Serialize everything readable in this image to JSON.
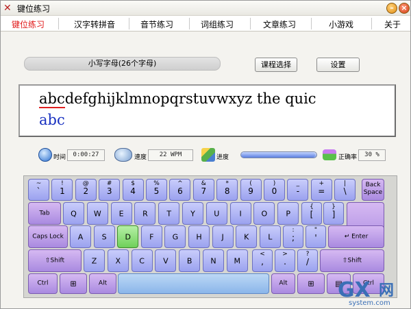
{
  "window": {
    "title": "键位练习",
    "minimize_icon": "minimize-icon",
    "close_icon": "close-icon"
  },
  "menu": {
    "items": [
      "键位练习",
      "汉字转拼音",
      "音节练习",
      "词组练习",
      "文章练习",
      "小游戏",
      "关于"
    ],
    "active_index": 0
  },
  "lesson": {
    "label": "小写字母(26个字母)"
  },
  "buttons": {
    "course_select": "课程选择",
    "settings": "设置"
  },
  "practice": {
    "line1_typed": "abc",
    "line1_rest": "defghijklmnopqrstuvwxyz the quic",
    "line2": "abc"
  },
  "stats": {
    "time_label": "时间",
    "time_value": "0:00:27",
    "speed_label": "速度",
    "speed_value": "22 WPM",
    "progress_label": "进度",
    "progress_fraction": 0.98,
    "accuracy_label": "正确率",
    "accuracy_value": "30 %"
  },
  "keyboard": {
    "row1": [
      [
        "~",
        "`"
      ],
      [
        "!",
        "1"
      ],
      [
        "@",
        "2"
      ],
      [
        "#",
        "3"
      ],
      [
        "$",
        "4"
      ],
      [
        "%",
        "5"
      ],
      [
        "^",
        "6"
      ],
      [
        "&",
        "7"
      ],
      [
        "*",
        "8"
      ],
      [
        "(",
        "9"
      ],
      [
        ")",
        "0"
      ],
      [
        "_",
        "-"
      ],
      [
        "+",
        "="
      ],
      [
        "|",
        "\\"
      ]
    ],
    "backspace": [
      "Back",
      "Space"
    ],
    "tab": "Tab",
    "row2": [
      "Q",
      "W",
      "E",
      "R",
      "T",
      "Y",
      "U",
      "I",
      "O",
      "P"
    ],
    "row2_brackets": [
      [
        "{",
        "["
      ],
      [
        "}",
        "]"
      ]
    ],
    "caps": "Caps Lock",
    "row3": [
      "A",
      "S",
      "D",
      "F",
      "G",
      "H",
      "J",
      "K",
      "L"
    ],
    "row3_punct": [
      [
        ":",
        ";"
      ],
      [
        "\"",
        "'"
      ]
    ],
    "enter": "Enter",
    "shift_left": "Shift",
    "row4": [
      "Z",
      "X",
      "C",
      "V",
      "B",
      "N",
      "M"
    ],
    "row4_punct": [
      [
        "<",
        ","
      ],
      [
        ">",
        "."
      ],
      [
        "?",
        "/"
      ]
    ],
    "shift_right": "Shift",
    "ctrl_left": "Ctrl",
    "alt_left": "Alt",
    "alt_right": "Alt",
    "ctrl_right": "Ctrl",
    "highlight_key": "D"
  },
  "watermark": {
    "text_big": "GX",
    "text_mid": "网",
    "text_small": "system.com"
  }
}
